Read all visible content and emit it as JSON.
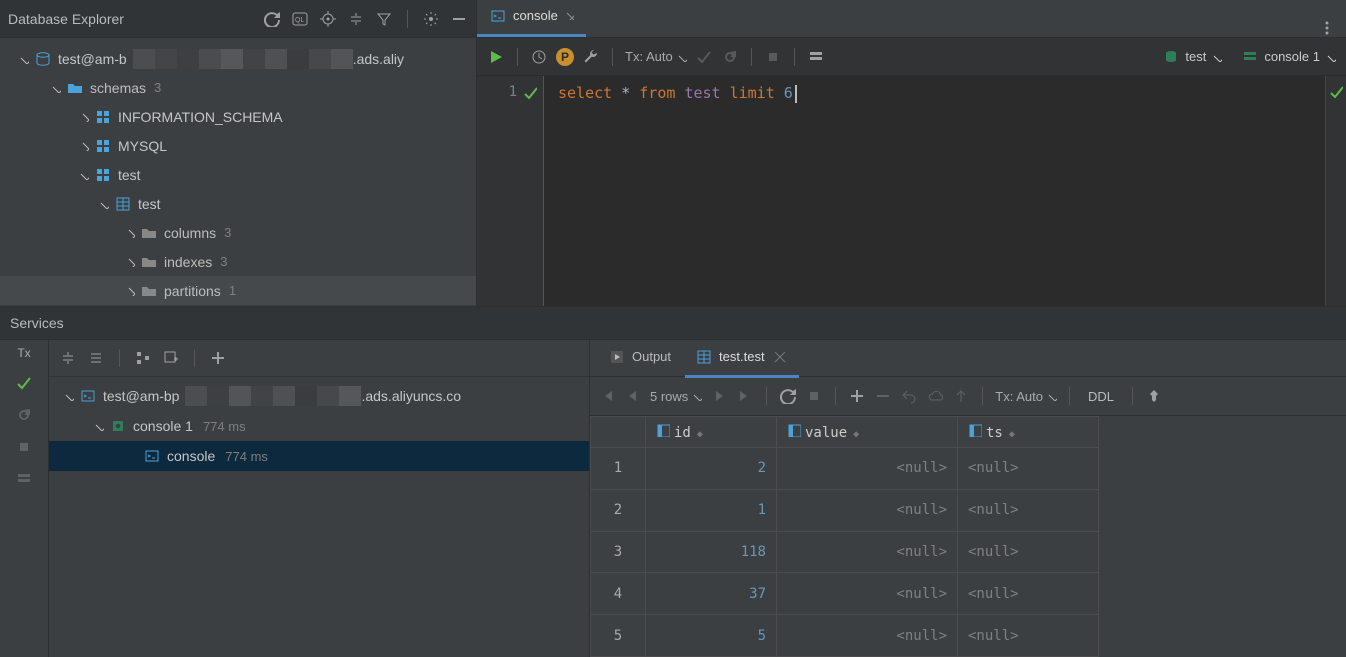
{
  "db_explorer": {
    "title": "Database Explorer",
    "datasource": {
      "name_prefix": "test@am-b",
      "name_suffix": ".ads.aliy"
    },
    "schemas_label": "schemas",
    "schemas_count": "3",
    "info_schema": "INFORMATION_SCHEMA",
    "mysql": "MYSQL",
    "test_schema": "test",
    "test_table": "test",
    "columns_label": "columns",
    "columns_count": "3",
    "indexes_label": "indexes",
    "indexes_count": "3",
    "partitions_label": "partitions",
    "partitions_count": "1"
  },
  "editor": {
    "tab_label": "console",
    "tx_label": "Tx: Auto",
    "chip_test": "test",
    "chip_console": "console 1",
    "line_num": "1",
    "sql": {
      "select": "select",
      "star": "*",
      "from": "from",
      "table": "test",
      "limit": "limit",
      "n": "6"
    }
  },
  "services": {
    "title": "Services",
    "tx_icon": "Tx",
    "datasource_prefix": "test@am-bp",
    "datasource_suffix": ".ads.aliyuncs.co",
    "console1": "console 1",
    "console1_time": "774 ms",
    "console": "console",
    "console_time": "774 ms",
    "output_tab": "Output",
    "result_tab": "test.test",
    "rows_label": "5 rows",
    "tx_label": "Tx: Auto",
    "ddl_label": "DDL",
    "cols": {
      "id": "id",
      "value": "value",
      "ts": "ts"
    },
    "rows": [
      {
        "n": "1",
        "id": "2",
        "value": "<null>",
        "ts": "<null>"
      },
      {
        "n": "2",
        "id": "1",
        "value": "<null>",
        "ts": "<null>"
      },
      {
        "n": "3",
        "id": "118",
        "value": "<null>",
        "ts": "<null>"
      },
      {
        "n": "4",
        "id": "37",
        "value": "<null>",
        "ts": "<null>"
      },
      {
        "n": "5",
        "id": "5",
        "value": "<null>",
        "ts": "<null>"
      }
    ]
  }
}
